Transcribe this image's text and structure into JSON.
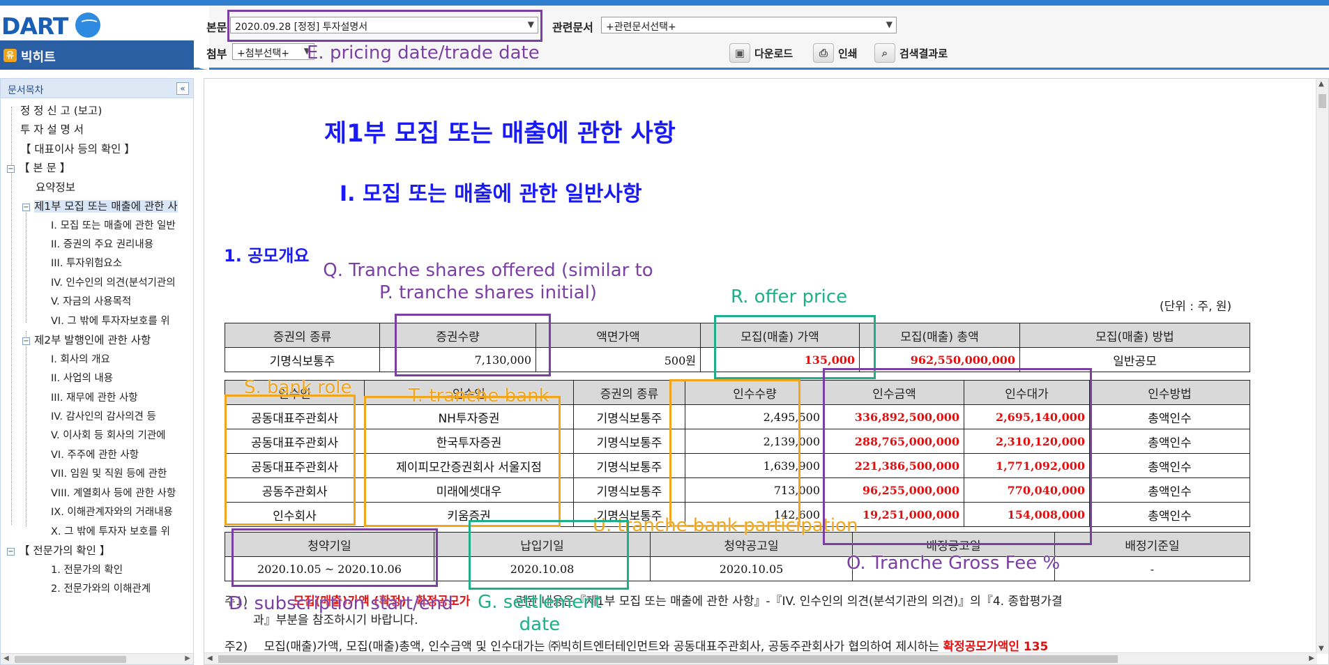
{
  "header": {
    "logo": "DART",
    "company_badge": "유",
    "company_name": "빅히트",
    "main_label": "본문",
    "main_select": "2020.09.28  [정정] 투자설명서",
    "related_label": "관련문서",
    "related_select": "+관련문서선택+",
    "attach_label": "첨부",
    "attach_select": "+첨부선택+",
    "download": "다운로드",
    "print": "인쇄",
    "search_results": "검색결과로"
  },
  "sidebar": {
    "title": "문서목차",
    "collapse": "«",
    "items": [
      "정 정 신 고 (보고)",
      "투 자 설 명 서",
      "【 대표이사 등의 확인 】",
      "【 본 문 】",
      "요약정보",
      "제1부 모집 또는 매출에 관한 사",
      "I. 모집 또는 매출에 관한 일반",
      "II. 증권의 주요 권리내용",
      "III. 투자위험요소",
      "IV. 인수인의 의견(분석기관의",
      "V. 자금의 사용목적",
      "VI. 그 밖에 투자자보호를 위",
      "제2부 발행인에 관한 사항",
      "I. 회사의 개요",
      "II. 사업의 내용",
      "III. 재무에 관한 사항",
      "IV. 감사인의 감사의견 등",
      "V. 이사회 등 회사의 기관에",
      "VI. 주주에 관한 사항",
      "VII. 임원 및 직원 등에 관한",
      "VIII. 계열회사 등에 관한 사항",
      "IX. 이해관계자와의 거래내용",
      "X. 그 밖에 투자자 보호를 위",
      "【 전문가의 확인 】",
      "1. 전문가의 확인",
      "2. 전문가와의 이해관계"
    ]
  },
  "doc": {
    "h1": "제1부 모집 또는 매출에 관한 사항",
    "h2": "I. 모집 또는 매출에 관한 일반사항",
    "h3": "1. 공모개요",
    "unit": "(단위 : 주, 원)",
    "t1": {
      "headers": [
        "증권의 종류",
        "증권수량",
        "액면가액",
        "모집(매출) 가액",
        "모집(매출) 총액",
        "모집(매출) 방법"
      ],
      "row": [
        "기명식보통주",
        "7,130,000",
        "500원",
        "135,000",
        "962,550,000,000",
        "일반공모"
      ]
    },
    "t2": {
      "headers": [
        "인수인",
        "인수인",
        "증권의 종류",
        "인수수량",
        "인수금액",
        "인수대가",
        "인수방법"
      ],
      "rows": [
        [
          "공동대표주관회사",
          "NH투자증권",
          "기명식보통주",
          "2,495,500",
          "336,892,500,000",
          "2,695,140,000",
          "총액인수"
        ],
        [
          "공동대표주관회사",
          "한국투자증권",
          "기명식보통주",
          "2,139,000",
          "288,765,000,000",
          "2,310,120,000",
          "총액인수"
        ],
        [
          "공동대표주관회사",
          "제이피모간증권회사 서울지점",
          "기명식보통주",
          "1,639,900",
          "221,386,500,000",
          "1,771,092,000",
          "총액인수"
        ],
        [
          "공동주관회사",
          "미래에셋대우",
          "기명식보통주",
          "713,000",
          "96,255,000,000",
          "770,040,000",
          "총액인수"
        ],
        [
          "인수회사",
          "키움증권",
          "기명식보통주",
          "142,600",
          "19,251,000,000",
          "154,008,000",
          "총액인수"
        ]
      ]
    },
    "t3": {
      "headers": [
        "청약기일",
        "납입기일",
        "청약공고일",
        "배정공고일",
        "배정기준일"
      ],
      "row": [
        "2020.10.05 ~ 2020.10.06",
        "2020.10.08",
        "2020.10.05",
        "",
        "-"
      ]
    },
    "note1_prefix": "주1)",
    "note1_red": "모집(매출)가액 (확정)",
    "note1_red2": "확정공모가",
    "note1_text": "련된 내용은『제1부 모집 또는 매출에 관한 사항』-『IV. 인수인의 의견(분석기관의 의견)』의『4. 종합평가결",
    "note1_line2": "과』부분을 참조하시기 바랍니다.",
    "note2_prefix": "주2)",
    "note2_text": "모집(매출)가액, 모집(매출)총액, 인수금액 및 인수대가는 ㈜빅히트엔터테인먼트와 공동대표주관회사, 공동주관회사가 협의하여 제시하는",
    "note2_red": "확정공모가액인 135"
  },
  "annotations": {
    "E": "E. pricing date/trade date",
    "Q1": "Q. Tranche shares offered (similar to",
    "Q2": "P. tranche shares initial)",
    "R": "R. offer price",
    "S": "S. bank role",
    "T": "T. tranche bank",
    "U": "U. tranche bank participation",
    "O": "O. Tranche Gross Fee %",
    "D": "D. subscription start/end",
    "G1": "G. settlement",
    "G2": "date"
  },
  "colors": {
    "purple": "#7b3fa3",
    "orange": "#f0a51c",
    "teal": "#1fae8a",
    "heading_blue": "#1a1af5",
    "value_red": "#e01010"
  }
}
